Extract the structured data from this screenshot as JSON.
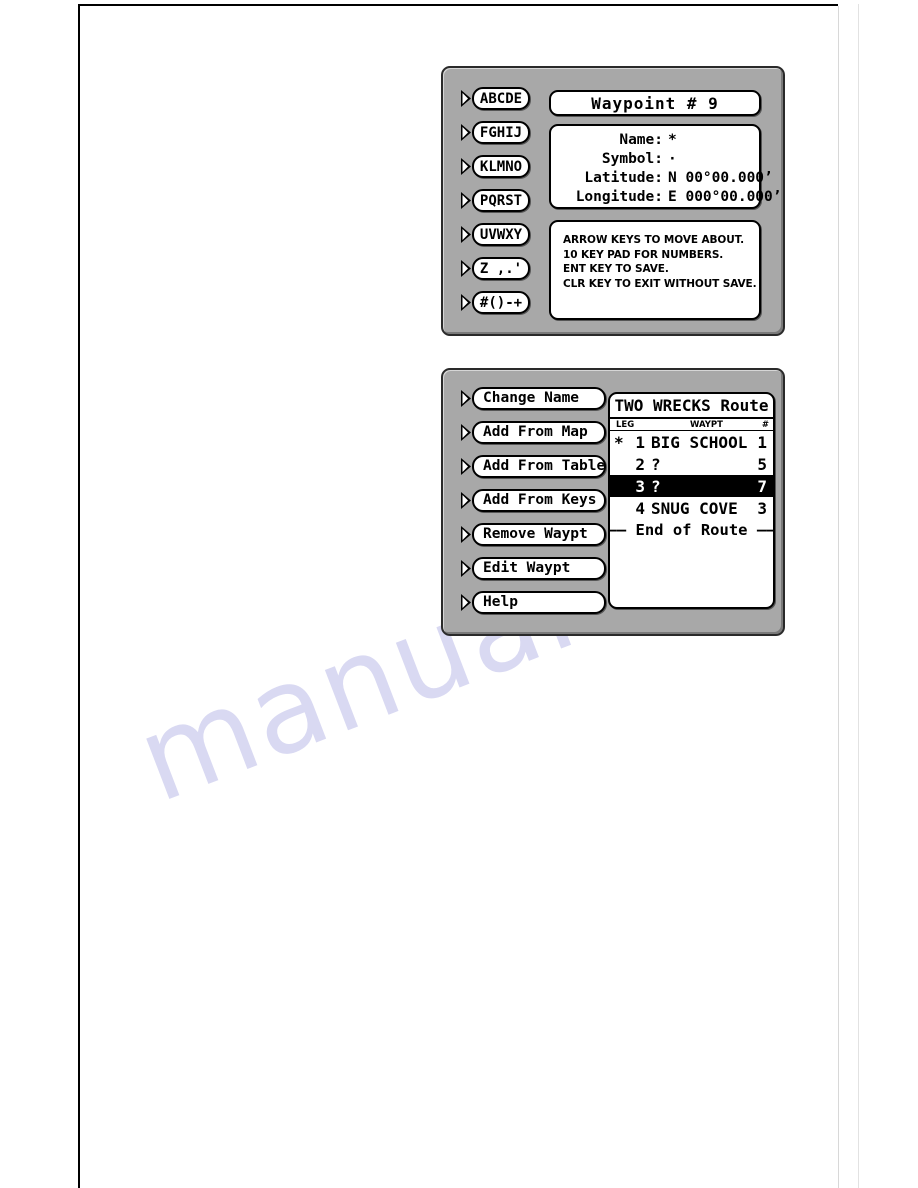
{
  "watermark": {
    "text": "manualslib"
  },
  "panel_waypoint_edit": {
    "name": "Waypoint Edit Screen",
    "softkeys": [
      {
        "label": "ABCDE",
        "icon": "arrow-right-icon"
      },
      {
        "label": "FGHIJ",
        "icon": "arrow-right-icon"
      },
      {
        "label": "KLMNO",
        "icon": "arrow-right-icon"
      },
      {
        "label": "PQRST",
        "icon": "arrow-right-icon"
      },
      {
        "label": "UVWXY",
        "icon": "arrow-right-icon"
      },
      {
        "label": "Z ,.'",
        "icon": "arrow-right-icon"
      },
      {
        "label": "#()-+",
        "icon": "arrow-right-icon"
      }
    ],
    "title": "Waypoint #  9",
    "fields": [
      {
        "label": "Name:",
        "value": "*"
      },
      {
        "label": "Symbol:",
        "value": "·"
      },
      {
        "label": "Latitude:",
        "value": "N  00°00.000’"
      },
      {
        "label": "Longitude:",
        "value": "E 000°00.000’"
      }
    ],
    "help_lines": [
      "ARROW KEYS TO MOVE ABOUT.",
      "10 KEY PAD FOR NUMBERS.",
      "ENT KEY TO SAVE.",
      "CLR KEY TO EXIT WITHOUT SAVE."
    ]
  },
  "panel_route_edit": {
    "name": "Route Edit Screen",
    "softkeys": [
      {
        "label": "Change Name",
        "icon": "arrow-right-icon"
      },
      {
        "label": "Add From Map",
        "icon": "arrow-right-icon"
      },
      {
        "label": "Add From Table",
        "icon": "arrow-right-icon"
      },
      {
        "label": "Add From Keys",
        "icon": "arrow-right-icon"
      },
      {
        "label": "Remove Waypt",
        "icon": "arrow-right-icon"
      },
      {
        "label": "Edit Waypt",
        "icon": "arrow-right-icon"
      },
      {
        "label": "Help",
        "icon": "arrow-right-icon"
      }
    ],
    "route_title": "TWO WRECKS Route",
    "columns": {
      "leg": "LEG",
      "waypt": "WAYPT",
      "num": "#"
    },
    "rows": [
      {
        "mark": "*",
        "leg": "1",
        "name": "BIG SCHOOL",
        "num": "1",
        "selected": false
      },
      {
        "mark": "",
        "leg": "2",
        "name": "?",
        "num": "5",
        "selected": false
      },
      {
        "mark": "",
        "leg": "3",
        "name": "?",
        "num": "7",
        "selected": true
      },
      {
        "mark": "",
        "leg": "4",
        "name": "SNUG COVE",
        "num": "3",
        "selected": false
      }
    ],
    "end_of_route": "–– End of Route ––"
  },
  "colors": {
    "panel_face": "#a8a8a8",
    "lcd_background": "#ffffff",
    "lcd_ink": "#000000",
    "selection": "#000000",
    "watermark": "#d9d9f2"
  }
}
